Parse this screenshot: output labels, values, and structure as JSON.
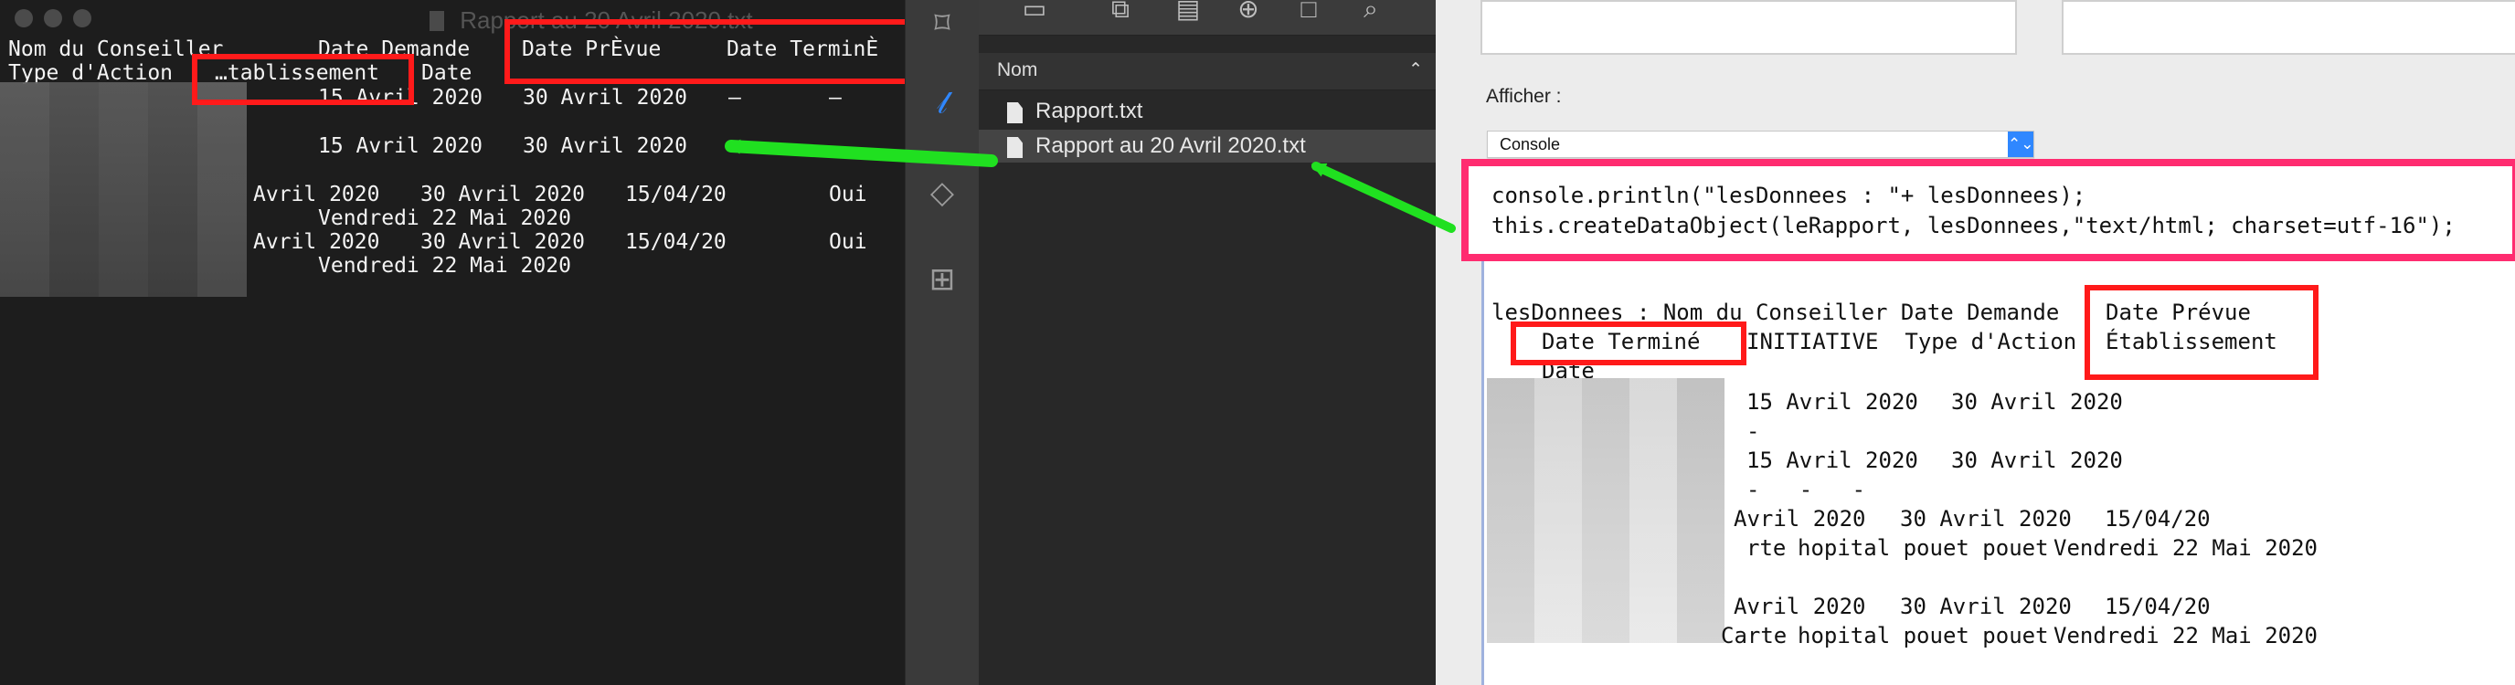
{
  "window": {
    "title": "Rapport au 20 Avril 2020.txt"
  },
  "terminal": {
    "headers": [
      "Nom du Conseiller",
      "Date Demande",
      "Type d'Action",
      "…tablissement",
      "Date",
      "Date PrÈvue",
      "Date TerminÈ"
    ],
    "rows": [
      [
        "15 Avril 2020",
        "30 Avril 2020",
        "–",
        "–"
      ],
      [
        "15 Avril 2020",
        "30 Avril 2020",
        "…"
      ],
      [
        "Avril 2020",
        "30 Avril 2020",
        "15/04/20",
        "Oui",
        "Vendredi 22 Mai 2020"
      ],
      [
        "Avril 2020",
        "30 Avril 2020",
        "15/04/20",
        "Oui",
        "Vendredi 22 Mai 2020"
      ]
    ]
  },
  "sidebar_icons": [
    "bookmark-icon",
    "paperclip-icon",
    "layers-icon",
    "hierarchy-icon"
  ],
  "toolbar_icons": [
    "toolbar-image-icon",
    "toolbar-copy-icon",
    "toolbar-print-icon",
    "toolbar-add-icon",
    "toolbar-trash-icon",
    "toolbar-search-icon"
  ],
  "files": {
    "header": "Nom",
    "items": [
      "Rapport.txt",
      "Rapport au 20 Avril 2020.txt"
    ]
  },
  "console": {
    "label": "Afficher :",
    "selected": "Console",
    "code": [
      "console.println(\"lesDonnees : \"+ lesDonnees);",
      "this.createDataObject(leRapport, lesDonnees,\"text/html; charset=utf-16\");"
    ],
    "output": {
      "line1": "lesDonnees : Nom du Conseiller Date Demande",
      "date_prevue": "Date Prévue",
      "date_termine": "Date Terminé",
      "initiative": "INITIATIVE  Type d'Action",
      "etablissement": "Établissement",
      "date": "Date",
      "rows": [
        [
          "15 Avril 2020",
          "30 Avril 2020"
        ],
        [
          "-"
        ],
        [
          "15 Avril 2020",
          "30 Avril 2020"
        ],
        [
          "-   -   -"
        ],
        [
          "Avril 2020",
          "30 Avril 2020",
          "15/04/20"
        ],
        [
          "rte",
          "hopital pouet pouet",
          "Vendredi 22 Mai 2020"
        ],
        [
          "Avril 2020",
          "30 Avril 2020",
          "15/04/20"
        ],
        [
          "Carte",
          "hopital pouet pouet",
          "Vendredi 22 Mai 2020"
        ]
      ]
    }
  },
  "colors": {
    "terminal_background": "#1d1d1d",
    "panel_background": "#282828",
    "console_background": "#ececec",
    "annotation_red": "#ff1a1a",
    "annotation_pink": "#ff2c70",
    "arrow_green": "#20e020",
    "select_accent": "#2f87ff"
  }
}
